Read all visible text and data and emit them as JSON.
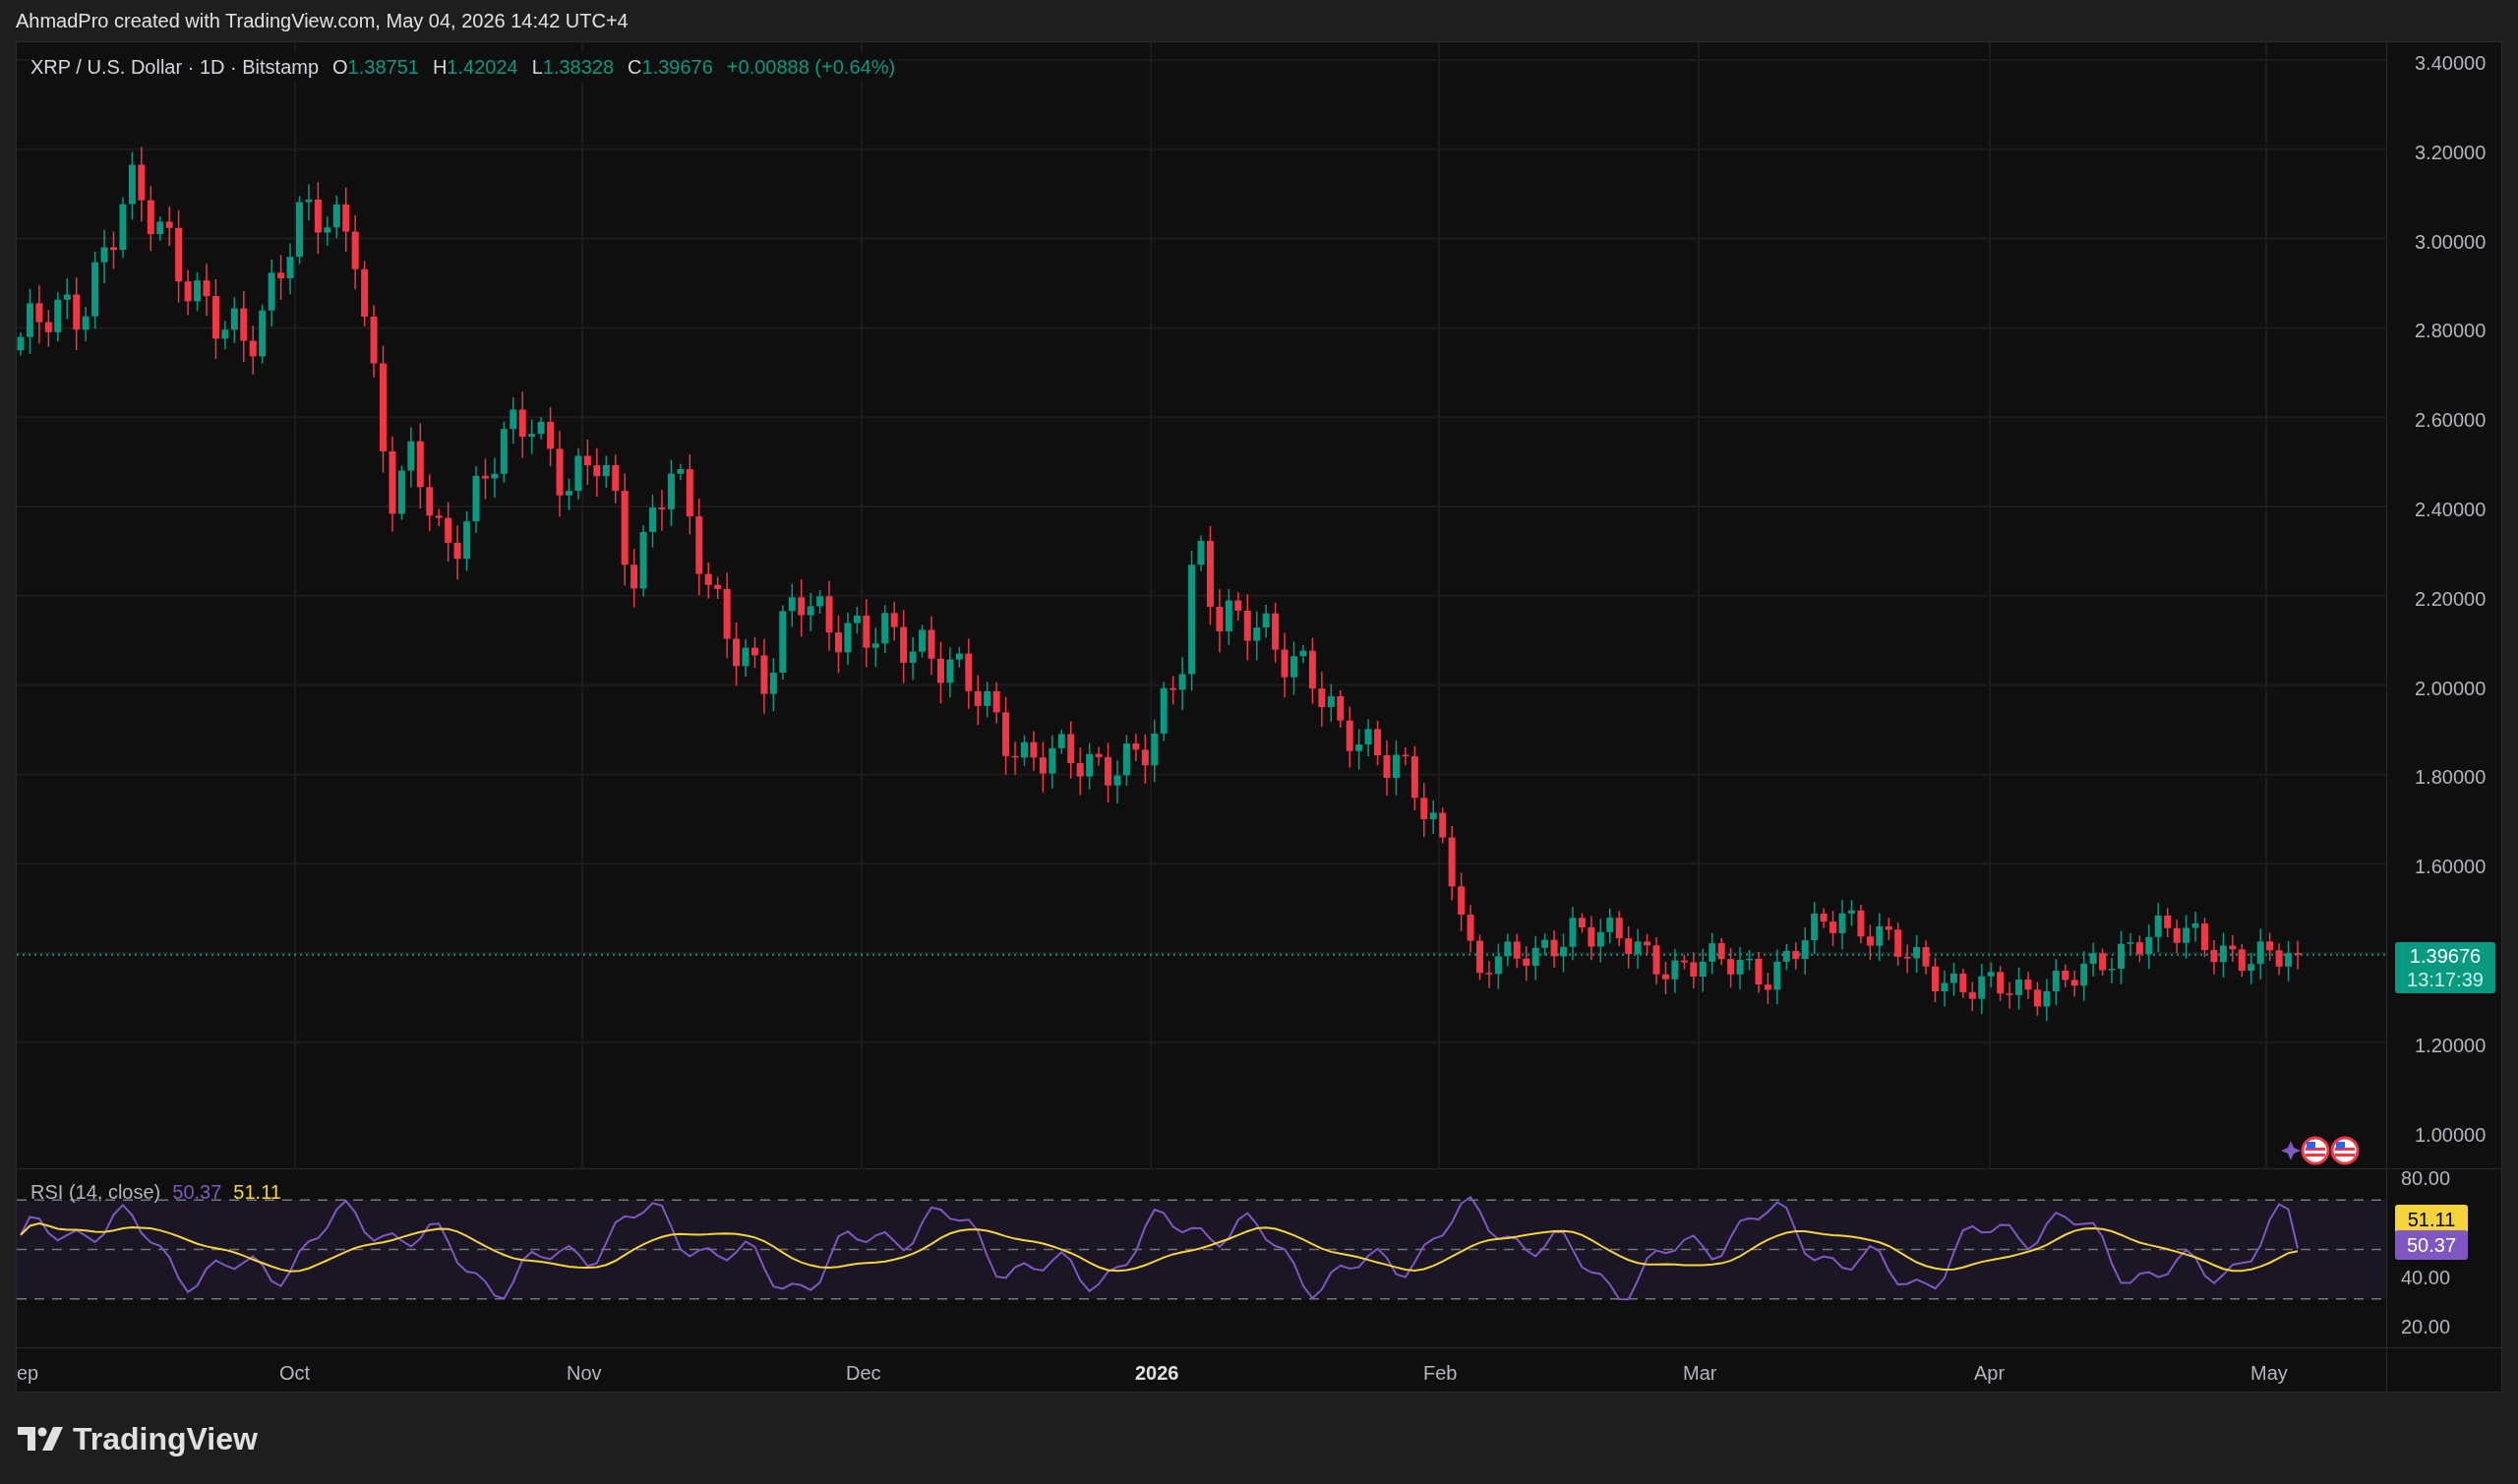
{
  "header": {
    "text": "AhmadPro created with TradingView.com, May 04, 2026 14:42 UTC+4"
  },
  "legend": {
    "symbol": "XRP / U.S. Dollar · 1D · Bitstamp",
    "ohlc": [
      {
        "label": "O",
        "value": "1.38751"
      },
      {
        "label": "H",
        "value": "1.42024"
      },
      {
        "label": "L",
        "value": "1.38328"
      },
      {
        "label": "C",
        "value": "1.39676"
      }
    ],
    "change": "+0.00888 (+0.64%)"
  },
  "price_axis": [
    "3.40000",
    "3.20000",
    "3.00000",
    "2.80000",
    "2.60000",
    "2.40000",
    "2.20000",
    "2.00000",
    "1.80000",
    "1.60000",
    "1.20000",
    "1.00000"
  ],
  "last_price": {
    "value": "1.39676",
    "countdown": "13:17:39"
  },
  "rsi": {
    "title": "RSI (14, close)",
    "value": "50.37",
    "ma": "51.11"
  },
  "rsi_axis": [
    "80.00",
    "40.00",
    "20.00"
  ],
  "rsi_badges": {
    "ma": "51.11",
    "value": "50.37"
  },
  "time_axis": [
    {
      "label": "ep",
      "kind": "month"
    },
    {
      "label": "Oct",
      "kind": "month"
    },
    {
      "label": "Nov",
      "kind": "month"
    },
    {
      "label": "Dec",
      "kind": "month"
    },
    {
      "label": "2026",
      "kind": "year"
    },
    {
      "label": "Feb",
      "kind": "month"
    },
    {
      "label": "Mar",
      "kind": "month"
    },
    {
      "label": "Apr",
      "kind": "month"
    },
    {
      "label": "May",
      "kind": "month"
    }
  ],
  "footer": {
    "brand": "TradingView"
  }
}
